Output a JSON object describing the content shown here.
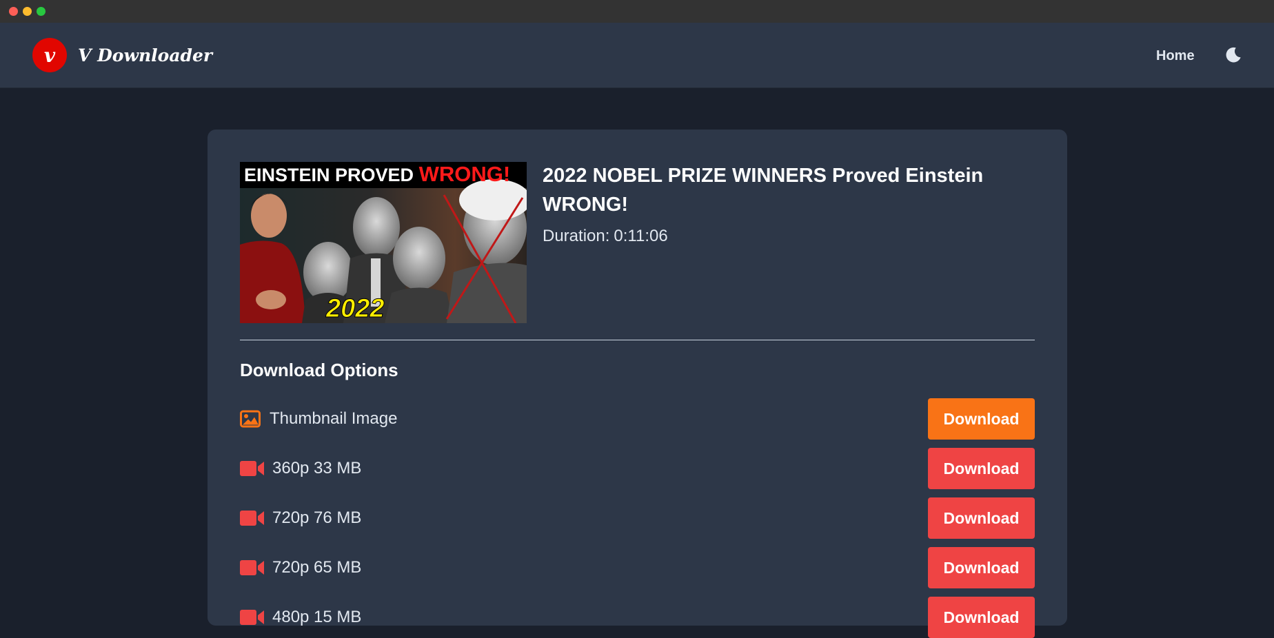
{
  "window": {
    "controls": [
      "close",
      "minimize",
      "maximize"
    ]
  },
  "header": {
    "logo_letter": "v",
    "brand": "V Downloader",
    "nav_home": "Home",
    "theme_icon": "moon-icon"
  },
  "video": {
    "thumbnail": {
      "headline_white": "EINSTEIN PROVED",
      "headline_red": "WRONG!",
      "year": "2022"
    },
    "title": "2022 NOBEL PRIZE WINNERS Proved Einstein WRONG!",
    "duration_label": "Duration:",
    "duration_value": "0:11:06"
  },
  "download_options": {
    "title": "Download Options",
    "items": [
      {
        "icon": "image-icon",
        "label": "Thumbnail Image",
        "button": "Download",
        "button_color": "#f97316"
      },
      {
        "icon": "video-camera-icon",
        "label": "360p 33 MB",
        "button": "Download",
        "button_color": "#ef4444"
      },
      {
        "icon": "video-camera-icon",
        "label": "720p 76 MB",
        "button": "Download",
        "button_color": "#ef4444"
      },
      {
        "icon": "video-camera-icon",
        "label": "720p 65 MB",
        "button": "Download",
        "button_color": "#ef4444"
      },
      {
        "icon": "video-camera-icon",
        "label": "480p 15 MB",
        "button": "Download",
        "button_color": "#ef4444"
      }
    ]
  },
  "colors": {
    "background": "#1a202c",
    "surface": "#2d3748",
    "accent_orange": "#f97316",
    "accent_red": "#ef4444",
    "logo_red": "#e10600"
  }
}
